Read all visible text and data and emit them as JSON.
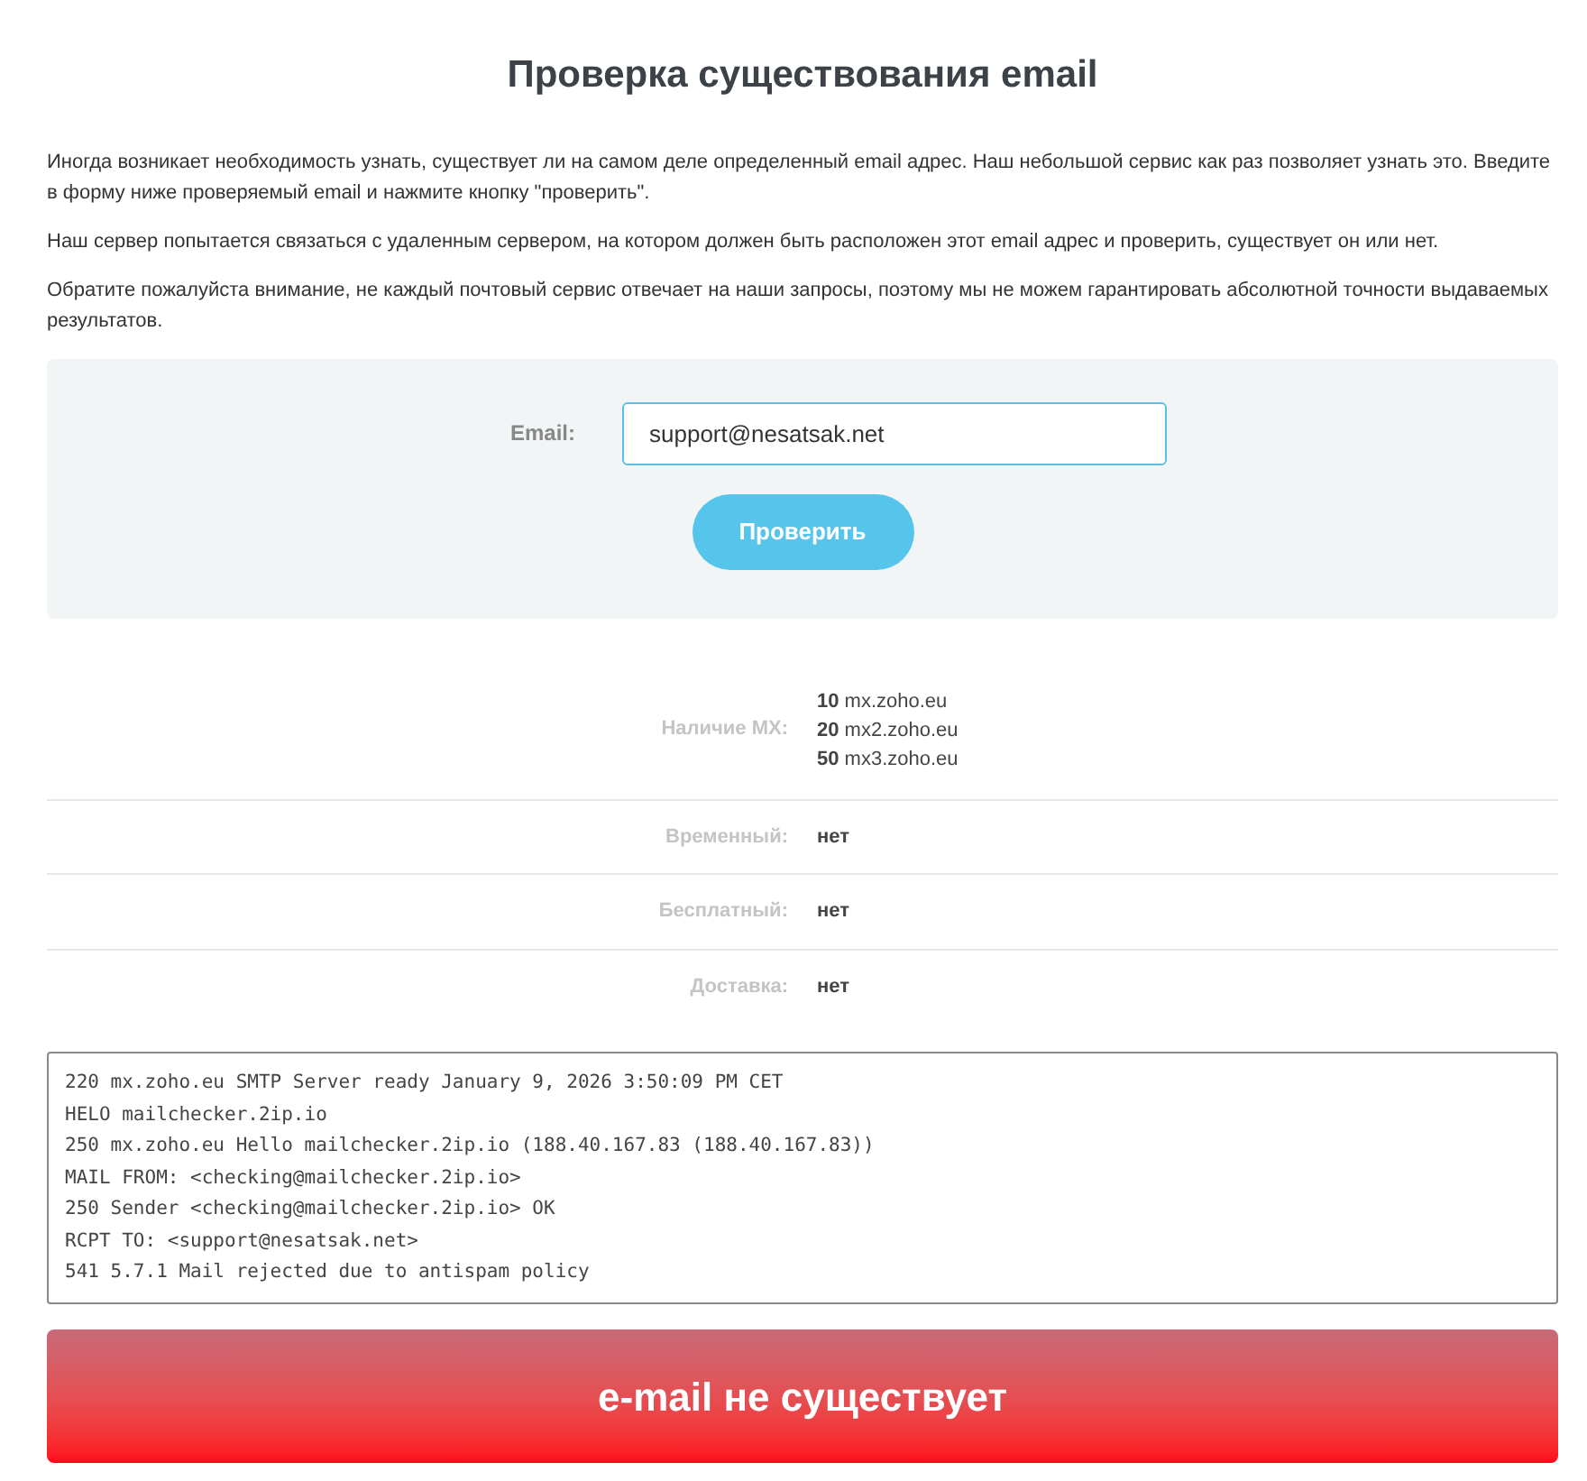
{
  "title": "Проверка существования email",
  "paragraphs": [
    "Иногда возникает необходимость узнать, существует ли на самом деле определенный email адрес. Наш небольшой сервис как раз позволяет узнать это. Введите в форму ниже проверяемый email и нажмите кнопку \"проверить\".",
    "Наш сервер попытается связаться с удаленным сервером, на котором должен быть расположен этот email адрес и проверить, существует он или нет.",
    "Обратите пожалуйста внимание, не каждый почтовый сервис отвечает на наши запросы, поэтому мы не можем гарантировать абсолютной точности выдаваемых результатов."
  ],
  "form": {
    "label": "Email:",
    "value": "support@nesatsak.net",
    "button": "Проверить"
  },
  "results": [
    {
      "kind": "mx",
      "label": "Наличие MX:",
      "mx": [
        {
          "priority": "10",
          "host": "mx.zoho.eu"
        },
        {
          "priority": "20",
          "host": "mx2.zoho.eu"
        },
        {
          "priority": "50",
          "host": "mx3.zoho.eu"
        }
      ]
    },
    {
      "kind": "text",
      "label": "Временный:",
      "value": "нет"
    },
    {
      "kind": "text",
      "label": "Бесплатный:",
      "value": "нет"
    },
    {
      "kind": "text",
      "label": "Доставка:",
      "value": "нет"
    }
  ],
  "log": [
    "220 mx.zoho.eu SMTP Server ready January 9, 2026 3:50:09 PM CET",
    "HELO mailchecker.2ip.io",
    "250 mx.zoho.eu Hello mailchecker.2ip.io (188.40.167.83 (188.40.167.83))",
    "MAIL FROM: <checking@mailchecker.2ip.io>",
    "250 Sender <checking@mailchecker.2ip.io> OK",
    "RCPT TO: <support@nesatsak.net>",
    "541 5.7.1 Mail rejected due to antispam policy"
  ],
  "verdict": {
    "text": "e-mail не существует",
    "exists": false
  }
}
